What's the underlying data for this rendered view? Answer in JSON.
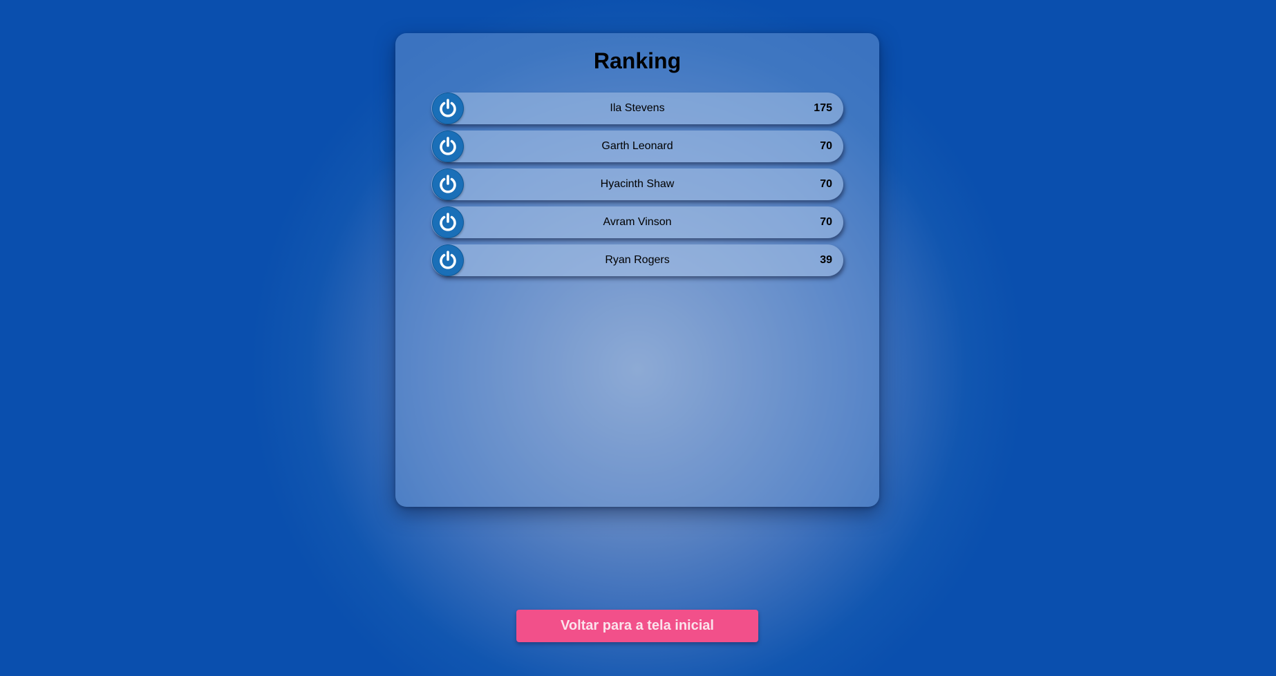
{
  "ranking": {
    "title": "Ranking",
    "players": [
      {
        "name": "Ila Stevens",
        "score": "175",
        "avatar_icon": "power-icon"
      },
      {
        "name": "Garth Leonard",
        "score": "70",
        "avatar_icon": "power-icon"
      },
      {
        "name": "Hyacinth Shaw",
        "score": "70",
        "avatar_icon": "power-icon"
      },
      {
        "name": "Avram Vinson",
        "score": "70",
        "avatar_icon": "power-icon"
      },
      {
        "name": "Ryan Rogers",
        "score": "39",
        "avatar_icon": "power-icon"
      }
    ]
  },
  "actions": {
    "back_label": "Voltar para a tela inicial"
  },
  "colors": {
    "background": "#0a4fae",
    "button": "#f2508a",
    "avatar": "#1a6fb8"
  }
}
